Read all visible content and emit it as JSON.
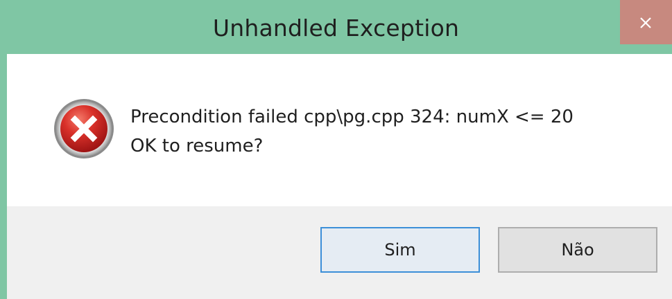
{
  "window": {
    "title": "Unhandled Exception",
    "close_icon": "close-icon",
    "accent_color": "#7fc6a4",
    "close_color": "#c7897f"
  },
  "dialog": {
    "icon": "error-icon",
    "message_line1": "Precondition failed cpp\\pg.cpp 324: numX <= 20",
    "message_line2": "OK to resume?"
  },
  "buttons": {
    "yes_label": "Sim",
    "no_label": "Não"
  }
}
